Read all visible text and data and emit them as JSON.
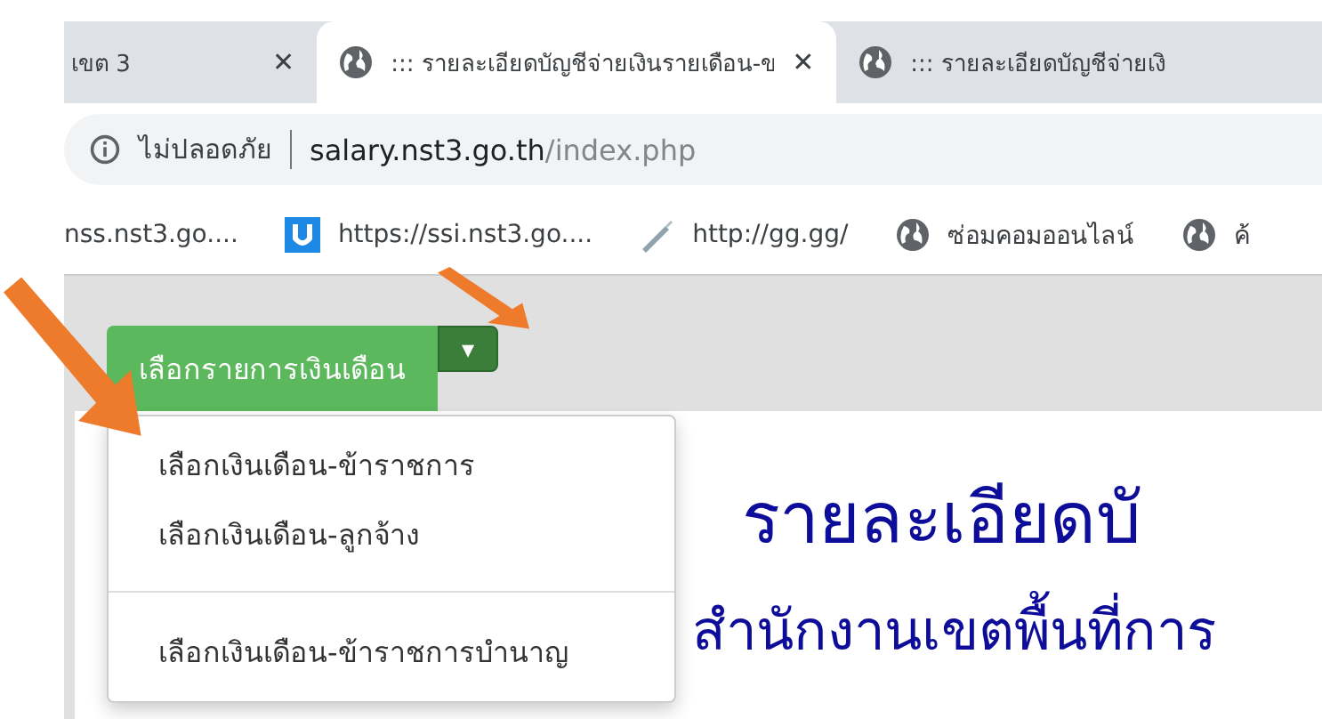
{
  "tabs": [
    {
      "title": "เขต 3",
      "kind": "plain",
      "selected": false,
      "close": "✕"
    },
    {
      "title": "::: รายละเอียดบัญชีจ่ายเงินรายเดือน-ข",
      "kind": "web",
      "selected": true,
      "close": "✕"
    },
    {
      "title": "::: รายละเอียดบัญชีจ่ายเงิ",
      "kind": "web",
      "selected": false
    }
  ],
  "address_bar": {
    "security": "ไม่ปลอดภัย",
    "host": "salary.nst3.go.th",
    "path": "/index.php"
  },
  "bookmarks": [
    {
      "label": "nss.nst3.go....",
      "kind": "plain"
    },
    {
      "label": "https://ssi.nst3.go....",
      "kind": "app"
    },
    {
      "label": "http://gg.gg/",
      "kind": "tool"
    },
    {
      "label": "ซ่อมคอมออนไลน์",
      "kind": "web"
    },
    {
      "label": "ค้",
      "kind": "web"
    }
  ],
  "page": {
    "split_button": {
      "label": "เลือกรายการเงินเดือน",
      "caret": "▾"
    },
    "dropdown": [
      {
        "label": "เลือกเงินเดือน-ข้าราชการ",
        "kind": "item"
      },
      {
        "label": "เลือกเงินเดือน-ลูกจ้าง",
        "kind": "item"
      },
      {
        "kind": "divider"
      },
      {
        "label": "เลือกเงินเดือน-ข้าราชการบำนาญ",
        "kind": "item"
      }
    ],
    "heading": "รายละเอียดบั",
    "subheading": "สำนักงานเขตพื้นที่การ"
  }
}
